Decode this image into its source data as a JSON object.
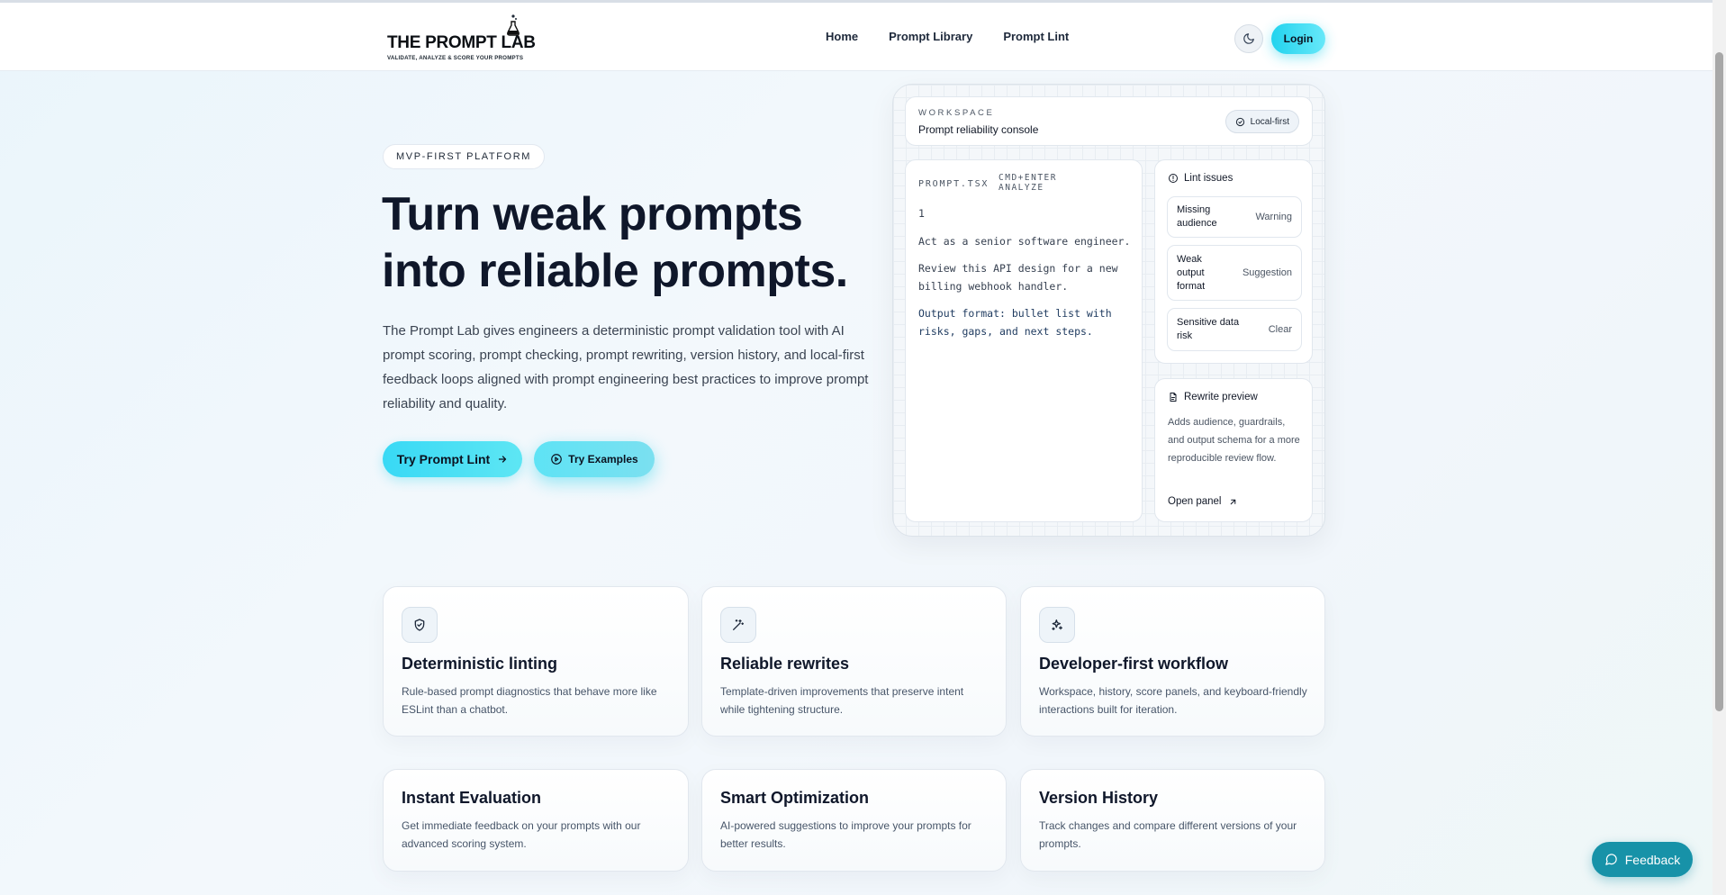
{
  "header": {
    "logo_title": "THE PROMPT LAB",
    "logo_subtitle": "VALIDATE, ANALYZE & SCORE YOUR PROMPTS",
    "nav": [
      {
        "label": "Home"
      },
      {
        "label": "Prompt Library"
      },
      {
        "label": "Prompt Lint"
      }
    ],
    "theme_icon": "moon-icon",
    "login_label": "Login"
  },
  "hero": {
    "badge": "MVP-FIRST PLATFORM",
    "title": "Turn weak prompts into reliable prompts.",
    "description": "The Prompt Lab gives engineers a deterministic prompt validation tool with AI prompt scoring, prompt checking, prompt rewriting, version history, and local-first feedback loops aligned with prompt engineering best practices to improve prompt reliability and quality.",
    "cta_primary": "Try Prompt Lint",
    "cta_secondary": "Try Examples"
  },
  "console": {
    "workspace_label": "WORKSPACE",
    "workspace_title": "Prompt reliability console",
    "local_pill": "Local-first",
    "editor": {
      "file_name": "PROMPT.TSX",
      "hint": "CMD+ENTER ANALYZE",
      "line_number": "1",
      "lines": [
        "Act as a senior software engineer.",
        "Review this API design for a new billing webhook handler.",
        "Output format: bullet list with risks, gaps, and next steps."
      ]
    },
    "lint": {
      "title": "Lint issues",
      "issues": [
        {
          "name": "Missing audience",
          "severity": "Warning"
        },
        {
          "name": "Weak output format",
          "severity": "Suggestion"
        },
        {
          "name": "Sensitive data risk",
          "severity": "Clear"
        }
      ]
    },
    "rewrite": {
      "title": "Rewrite preview",
      "body": "Adds audience, guardrails, and output schema for a more reproducible review flow.",
      "link": "Open panel"
    }
  },
  "features": [
    {
      "icon": "shield-check-icon",
      "title": "Deterministic linting",
      "desc": "Rule-based prompt diagnostics that behave more like ESLint than a chatbot."
    },
    {
      "icon": "magic-wand-icon",
      "title": "Reliable rewrites",
      "desc": "Template-driven improvements that preserve intent while tightening structure."
    },
    {
      "icon": "sparkles-icon",
      "title": "Developer-first workflow",
      "desc": "Workspace, history, score panels, and keyboard-friendly interactions built for iteration."
    },
    {
      "title": "Instant Evaluation",
      "desc": "Get immediate feedback on your prompts with our advanced scoring system."
    },
    {
      "title": "Smart Optimization",
      "desc": "AI-powered suggestions to improve your prompts for better results."
    },
    {
      "title": "Version History",
      "desc": "Track changes and compare different versions of your prompts."
    }
  ],
  "feedback_label": "Feedback",
  "colors": {
    "accent": "#22d3ee",
    "feedback": "#1792a8",
    "text": "#0f172a"
  }
}
